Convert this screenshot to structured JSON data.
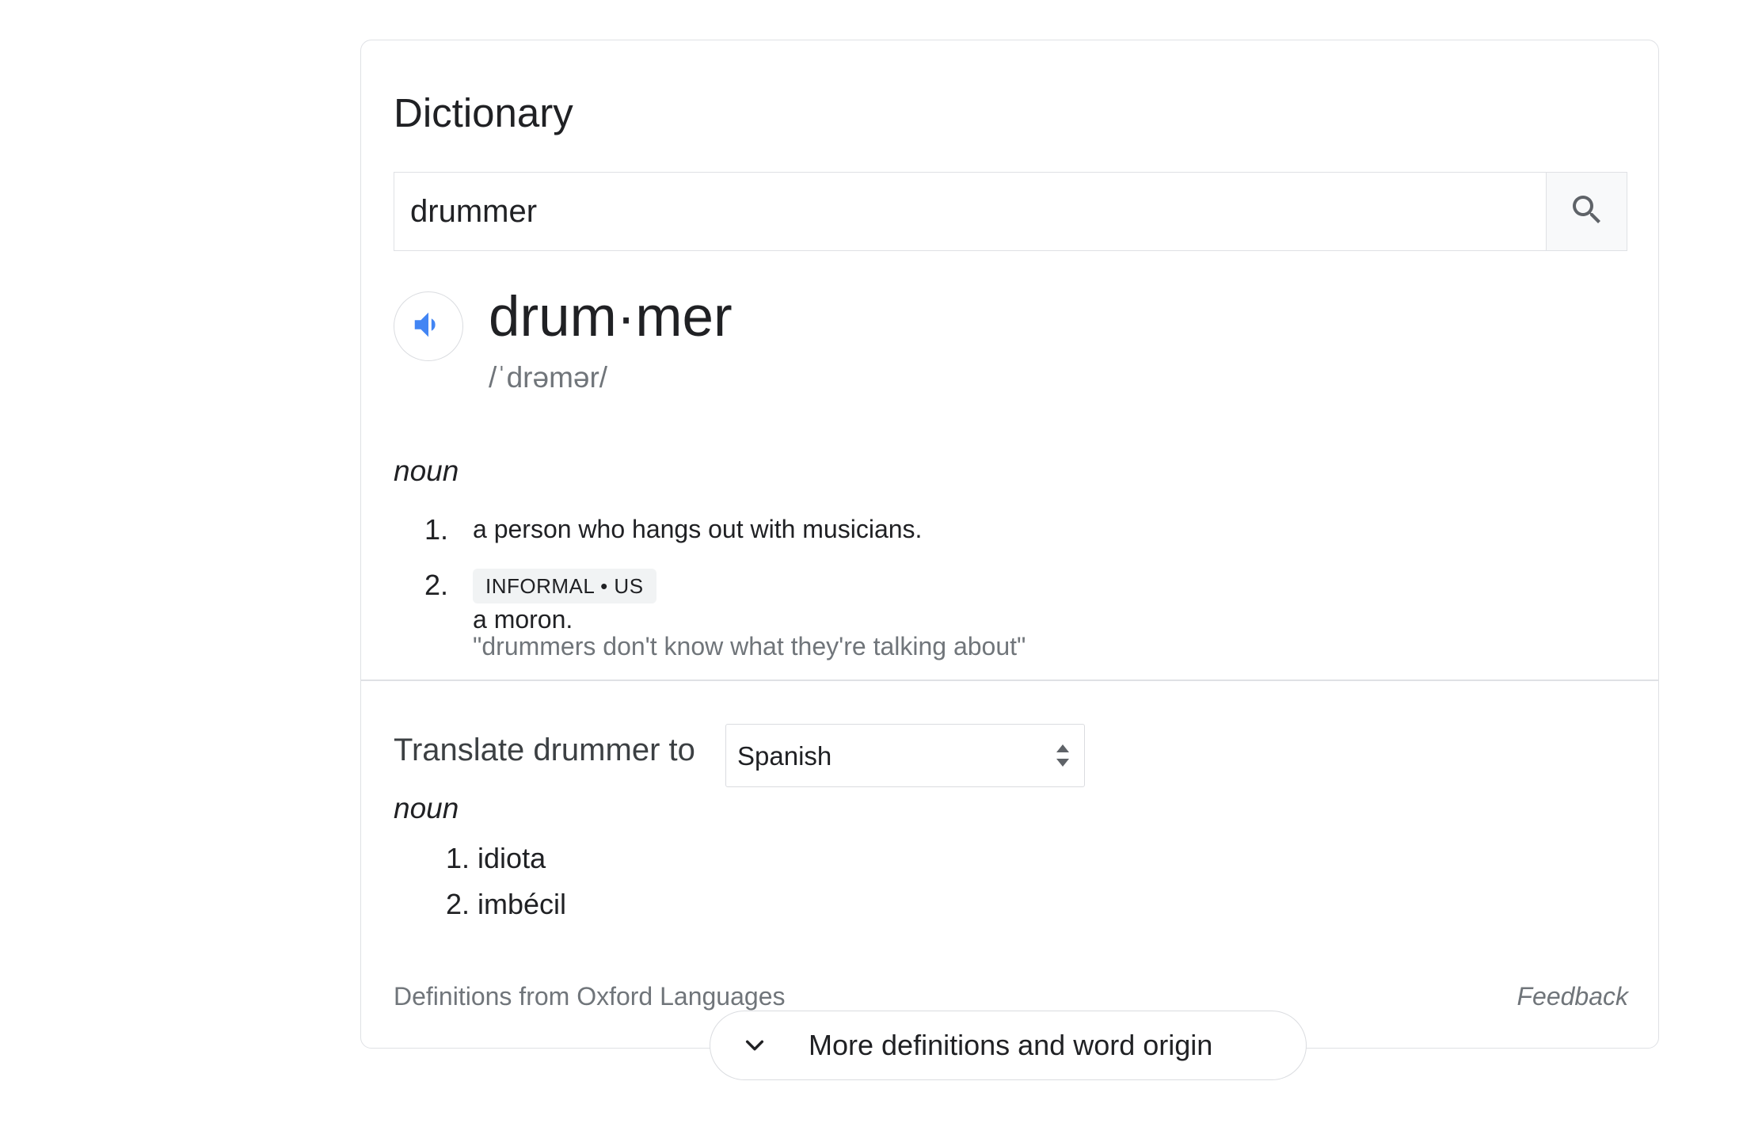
{
  "dictionary": {
    "title": "Dictionary",
    "search": {
      "value": "drummer",
      "icon": "search-icon"
    },
    "entry": {
      "speaker_icon": "speaker-icon",
      "headword": "drum·mer",
      "phonetic": "/ˈdrəmər/",
      "part_of_speech": "noun",
      "definitions": [
        {
          "number": "1.",
          "text": "a person who hangs out with musicians."
        },
        {
          "number": "2.",
          "label": "INFORMAL • US",
          "text": "a moron.",
          "example": "\"drummers don't know what they're talking about\""
        }
      ]
    },
    "translate": {
      "label": "Translate drummer to",
      "selected_language": "Spanish",
      "part_of_speech": "noun",
      "items": [
        {
          "number": "1.",
          "text": "idiota"
        },
        {
          "number": "2.",
          "text": "imbécil"
        }
      ]
    },
    "footer": {
      "source": "Definitions from Oxford Languages",
      "feedback": "Feedback"
    },
    "more_button": {
      "label": "More definitions and word origin",
      "icon": "chevron-down-icon"
    },
    "colors": {
      "speaker_blue": "#4285f4",
      "border": "#dfe1e5",
      "secondary_text": "#70757a"
    }
  }
}
